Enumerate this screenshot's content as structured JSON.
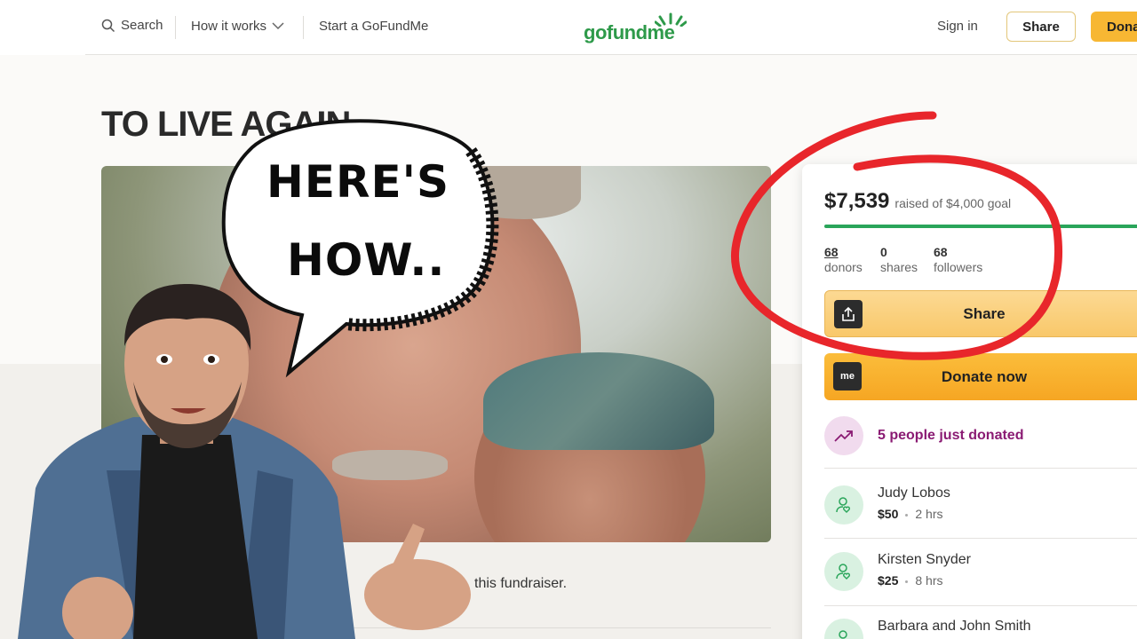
{
  "header": {
    "search_label": "Search",
    "how_label": "How it works",
    "start_label": "Start a GoFundMe",
    "logo_text": "gofundme",
    "sign_in_label": "Sign in",
    "share_label": "Share",
    "donate_label": "Dona"
  },
  "campaign": {
    "title": "TO LIVE AGAIN",
    "fundraiser_text": "this fundraiser."
  },
  "overlay": {
    "bubble_line1": "HERE'S",
    "bubble_line2": "HOW.."
  },
  "sidebar": {
    "raised_amount": "$7,539",
    "raised_goal": "raised of $4,000 goal",
    "stats": [
      {
        "value": "68",
        "label": "donors"
      },
      {
        "value": "0",
        "label": "shares"
      },
      {
        "value": "68",
        "label": "followers"
      }
    ],
    "share_button": "Share",
    "donate_button": "Donate now",
    "donate_icon_text": "me",
    "recent_text": "5 people just donated",
    "donors": [
      {
        "name": "Judy Lobos",
        "amount": "$50",
        "time": "2 hrs"
      },
      {
        "name": "Kirsten Snyder",
        "amount": "$25",
        "time": "8 hrs"
      },
      {
        "name": "Barbara and John Smith",
        "amount": "",
        "time": ""
      }
    ]
  },
  "colors": {
    "accent_green": "#2aa55a",
    "donate_orange": "#f6a623",
    "highlight_red": "#e8262b",
    "recent_purple": "#8a1b73"
  },
  "icons": {
    "search": "search-icon",
    "chevron": "chevron-down-icon",
    "share": "share-upload-icon",
    "trend": "trending-up-icon",
    "donor": "donor-heart-icon"
  }
}
